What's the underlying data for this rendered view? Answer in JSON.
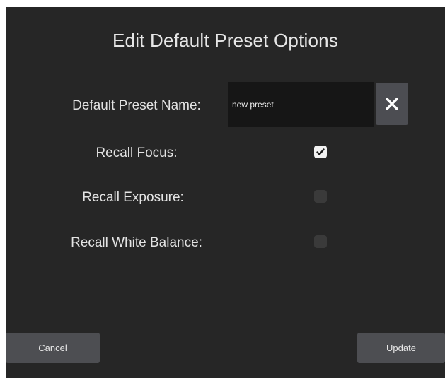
{
  "dialog": {
    "title": "Edit Default Preset Options"
  },
  "fields": {
    "preset_name_label": "Default Preset Name:",
    "preset_name_value": "new preset",
    "clear_icon": "close-icon",
    "recall_focus_label": "Recall Focus:",
    "recall_focus_checked": true,
    "recall_exposure_label": "Recall Exposure:",
    "recall_exposure_checked": false,
    "recall_white_balance_label": "Recall White Balance:",
    "recall_white_balance_checked": false
  },
  "buttons": {
    "cancel_label": "Cancel",
    "update_label": "Update"
  },
  "colors": {
    "background": "#262626",
    "input_background": "#161616",
    "button_background": "#4d4e52"
  }
}
